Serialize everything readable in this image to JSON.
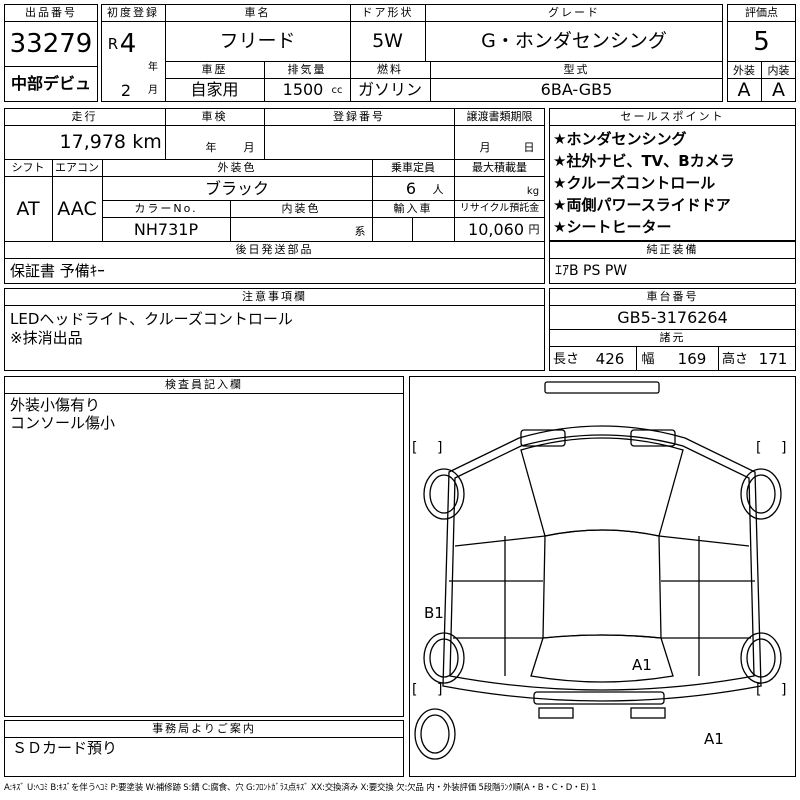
{
  "header": {
    "lot_label": "出品番号",
    "lot_no": "33279",
    "dealer": "中部デビュ",
    "reg_label": "初度登録",
    "era": "R",
    "year": "4",
    "year_unit": "年",
    "month": "2",
    "month_unit": "月",
    "name_label": "車名",
    "car_name": "フリード",
    "door_label": "ドア形状",
    "door": "5W",
    "grade_label": "グレード",
    "grade": "G・ホンダセンシング",
    "score_label": "評価点",
    "score": "5",
    "history_label": "車歴",
    "history": "自家用",
    "disp_label": "排気量",
    "displacement": "1500",
    "disp_unit": "cc",
    "fuel_label": "燃料",
    "fuel": "ガソリン",
    "model_label": "型式",
    "model": "6BA-GB5",
    "ext_label": "外装",
    "ext_grade": "A",
    "int_label": "内装",
    "int_grade": "A"
  },
  "mid": {
    "mileage_label": "走行",
    "mileage": "17,978",
    "mileage_unit": "km",
    "inspection_label": "車検",
    "insp_year": "年",
    "insp_month": "月",
    "plate_label": "登録番号",
    "transfer_label": "譲渡書類期限",
    "trans_month": "月",
    "trans_day": "日",
    "shift_label": "シフト",
    "shift": "AT",
    "ac_label": "エアコン",
    "ac": "AAC",
    "color_label": "外装色",
    "color": "ブラック",
    "capacity_label": "乗車定員",
    "capacity": "6",
    "capacity_unit": "人",
    "load_label": "最大積載量",
    "load_unit": "kg",
    "colorno_label": "カラーNo.",
    "color_no": "NH731P",
    "intcolor_label": "内装色",
    "intcolor_unit": "系",
    "import_label": "輸入車",
    "recycle_label": "リサイクル預託金",
    "recycle": "10,060",
    "recycle_unit": "円",
    "parts_label": "後日発送部品",
    "parts": "保証書 予備ｷｰ"
  },
  "sales": {
    "label": "セールスポイント",
    "points": [
      "★ホンダセンシング",
      "★社外ナビ、TV、Bカメラ",
      "★クルーズコントロール",
      "★両側パワースライドドア",
      "★シートヒーター"
    ]
  },
  "equipment": {
    "label": "純正装備",
    "value": "ｴｱB PS PW"
  },
  "notes": {
    "label": "注意事項欄",
    "lines": [
      "LEDヘッドライト、クルーズコントロール",
      "※抹消出品"
    ]
  },
  "chassis": {
    "label": "車台番号",
    "value": "GB5-3176264"
  },
  "dims": {
    "label": "諸元",
    "len_label": "長さ",
    "len": "426",
    "wid_label": "幅",
    "wid": "169",
    "hgt_label": "高さ",
    "hgt": "171"
  },
  "inspector": {
    "label": "検査員記入欄",
    "lines": [
      "外装小傷有り",
      "コンソール傷小"
    ]
  },
  "office": {
    "label": "事務局よりご案内",
    "text": "ＳＤカード預り"
  },
  "diagram": {
    "marks": [
      "B1",
      "A1",
      "A1"
    ],
    "bracket_open": "[",
    "bracket_close": "]"
  },
  "legend": "A:ｷｽﾞ U:ﾍｺﾐ B:ｷｽﾞを伴うﾍｺﾐ P:要塗装 W:補修跡 S:錆 C:腐食、穴 G:ﾌﾛﾝﾄｶﾞﾗｽ点ｷｽﾞ XX:交換済み X:要交換 欠:欠品 内・外装評価 5段階ﾗﾝｸ順(A・B・C・D・E) 1"
}
